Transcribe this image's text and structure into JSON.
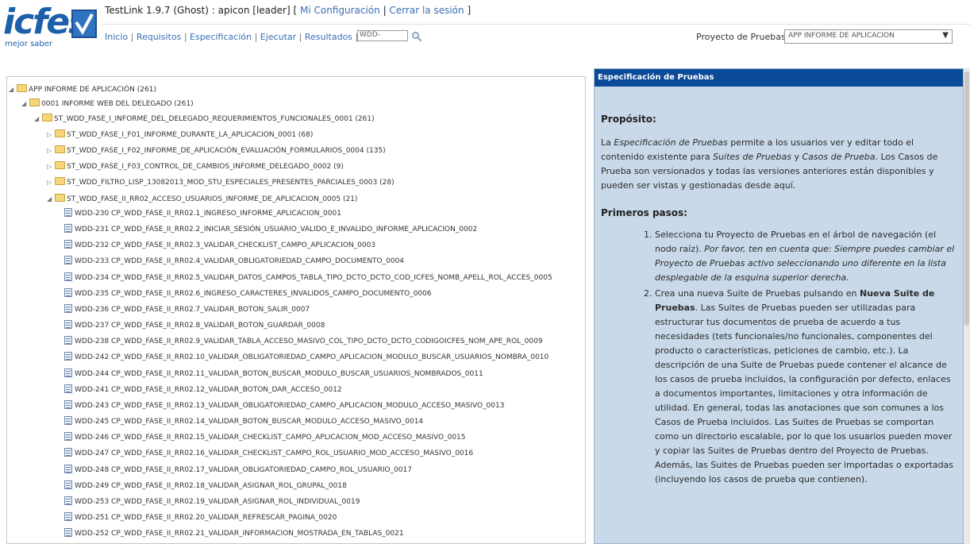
{
  "logo": {
    "brand": "icfes",
    "tagline": "mejor saber"
  },
  "header": {
    "title": "TestLink 1.9.7 (Ghost) : apicon [leader]",
    "config_link": "Mi Configuración",
    "logout_link": "Cerrar la sesión"
  },
  "menu": {
    "items": [
      "Inicio",
      "Requisitos",
      "Especificación",
      "Ejecutar",
      "Resultados"
    ],
    "search_value": "WDD-"
  },
  "project": {
    "label": "Proyecto de Pruebas",
    "selected": "APP INFORME DE APLICACION"
  },
  "tree": {
    "root": "APP INFORME DE APLICACIÓN (261)",
    "suite1": "0001 INFORME WEB DEL DELEGADO (261)",
    "suite2": "ST_WDD_FASE_I_INFORME_DEL_DELEGADO_REQUERIMIENTOS_FUNCIONALES_0001 (261)",
    "folders": [
      "ST_WDD_FASE_I_F01_INFORME_DURANTE_LA_APLICACION_0001 (68)",
      "ST_WDD_FASE_I_F02_INFORME_DE_APLICACIÓN_EVALUACIÓN_FORMULARIOS_0004 (135)",
      "ST_WDD_FASE_I_F03_CONTROL_DE_CAMBIOS_INFORME_DELEGADO_0002 (9)",
      "ST_WDD_FILTRO_LISP_13082013_MOD_STU_ESPECIALES_PRESENTES_PARCIALES_0003 (28)"
    ],
    "open_folder": "ST_WDD_FASE_II_RR02_ACCESO_USUARIOS_INFORME_DE_APLICACION_0005 (21)",
    "cases": [
      "WDD-230 CP_WDD_FASE_II_RR02.1_INGRESO_INFORME_APLICACION_0001",
      "WDD-231 CP_WDD_FASE_II_RR02.2_INICIAR_SESIÓN_USUARIO_VALIDO_E_INVALIDO_INFORME_APLICACION_0002",
      "WDD-232 CP_WDD_FASE_II_RR02.3_VALIDAR_CHECKLIST_CAMPO_APLICACION_0003",
      "WDD-233 CP_WDD_FASE_II_RR02.4_VALIDAR_OBLIGATORIEDAD_CAMPO_DOCUMENTO_0004",
      "WDD-234 CP_WDD_FASE_II_RR02.5_VALIDAR_DATOS_CAMPOS_TABLA_TIPO_DCTO_DCTO_COD_ICFES_NOMB_APELL_ROL_ACCES_0005",
      "WDD-235 CP_WDD_FASE_II_RR02.6_INGRESO_CARACTERES_INVALIDOS_CAMPO_DOCUMENTO_0006",
      "WDD-236 CP_WDD_FASE_II_RR02.7_VALIDAR_BOTON_SALIR_0007",
      "WDD-237 CP_WDD_FASE_II_RR02.8_VALIDAR_BOTON_GUARDAR_0008",
      "WDD-238 CP_WDD_FASE_II_RR02.9_VALIDAR_TABLA_ACCESO_MASIVO_COL_TIPO_DCTO_DCTO_CODIGOICFES_NOM_APE_ROL_0009",
      "WDD-242 CP_WDD_FASE_II_RR02.10_VALIDAR_OBLIGATORIEDAD_CAMPO_APLICACION_MODULO_BUSCAR_USUARIOS_NOMBRA_0010",
      "WDD-244 CP_WDD_FASE_II_RR02.11_VALIDAR_BOTON_BUSCAR_MODULO_BUSCAR_USUARIOS_NOMBRADOS_0011",
      "WDD-241 CP_WDD_FASE_II_RR02.12_VALIDAR_BOTON_DAR_ACCESO_0012",
      "WDD-243 CP_WDD_FASE_II_RR02.13_VALIDAR_OBLIGATORIEDAD_CAMPO_APLICACION_MODULO_ACCESO_MASIVO_0013",
      "WDD-245 CP_WDD_FASE_II_RR02.14_VALIDAR_BOTON_BUSCAR_MODULO_ACCESO_MASIVO_0014",
      "WDD-246 CP_WDD_FASE_II_RR02.15_VALIDAR_CHECKLIST_CAMPO_APLICACION_MOD_ACCESO_MASIVO_0015",
      "WDD-247 CP_WDD_FASE_II_RR02.16_VALIDAR_CHECKLIST_CAMPO_ROL_USUARIO_MOD_ACCESO_MASIVO_0016",
      "WDD-248 CP_WDD_FASE_II_RR02.17_VALIDAR_OBLIGATORIEDAD_CAMPO_ROL_USUARIO_0017",
      "WDD-249 CP_WDD_FASE_II_RR02.18_VALIDAR_ASIGNAR_ROL_GRUPAL_0018",
      "WDD-253 CP_WDD_FASE_II_RR02.19_VALIDAR_ASIGNAR_ROL_INDIVIDUAL_0019",
      "WDD-251 CP_WDD_FASE_II_RR02.20_VALIDAR_REFRESCAR_PAGINA_0020",
      "WDD-252 CP_WDD_FASE_II_RR02.21_VALIDAR_INFORMACION_MOSTRADA_EN_TABLAS_0021"
    ]
  },
  "spec": {
    "header": "Especificación de Pruebas",
    "purpose_title": "Propósito:",
    "purpose": {
      "p1": "La ",
      "p2": "Especificación de Pruebas",
      "p3": " permite a los usuarios ver y editar todo el contenido existente para ",
      "p4": "Suites de Pruebas",
      "p5": " y ",
      "p6": "Casos de Prueba",
      "p7": ". Los Casos de Prueba son versionados y todas las versiones anteriores están disponibles y pueden ser vistas y gestionadas desde aquí."
    },
    "steps_title": "Primeros pasos:",
    "step1": {
      "a": "Selecciona tu Proyecto de Pruebas en el árbol de navegación (el nodo raíz). ",
      "b": "Por favor, ten en cuenta que: Siempre puedes cambiar el Proyecto de Pruebas activo seleccionando uno diferente en la lista desplegable de la esquina superior derecha."
    },
    "step2": {
      "a": "Crea una nueva Suite de Pruebas pulsando en ",
      "b": "Nueva Suite de Pruebas",
      "c": ". Las Suites de Pruebas pueden ser utilizadas para estructurar tus documentos de prueba de acuerdo a tus necesidades (tets funcionales/no funcionales, componentes del producto o características, peticiones de cambio, etc.). La descripción de una Suite de Pruebas puede contener el alcance de los casos de prueba incluidos, la configuración por defecto, enlaces a documentos importantes, limitaciones y otra información de utilidad. En general, todas las anotaciones que son comunes a los Casos de Prueba incluidos. Las Suites de Pruebas se comportan como un directorio escalable, por lo que los usuarios pueden mover y copiar las Suites de Pruebas dentro del Proyecto de Pruebas. Además, las Suites de Pruebas pueden ser importadas o exportadas (incluyendo los casos de prueba que contienen)."
    }
  }
}
